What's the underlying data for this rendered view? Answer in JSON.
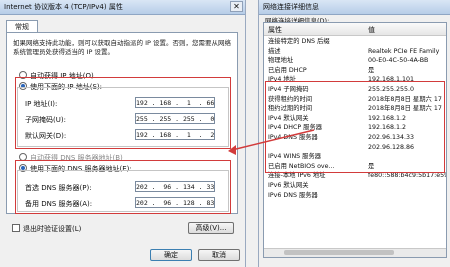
{
  "left_window": {
    "title": "Internet 协议版本 4 (TCP/IPv4) 属性",
    "tab": "常规",
    "description": "如果网络支持此功能，则可以获取自动指派的 IP 设置。否则，您需要从网络系统管理员处获得适当的 IP 设置。",
    "auto_ip": "自动获得 IP 地址(O)",
    "manual_ip": "使用下面的 IP 地址(S):",
    "ip_label": "IP 地址(I):",
    "ip_value": "192 . 168 .  1  . 66",
    "mask_label": "子网掩码(U):",
    "mask_value": "255 . 255 . 255 .  0",
    "gateway_label": "默认网关(D):",
    "gateway_value": "192 . 168 .  1  .  2",
    "auto_dns": "自动获得 DNS 服务器地址(B)",
    "manual_dns": "使用下面的 DNS 服务器地址(E):",
    "dns1_label": "首选 DNS 服务器(P):",
    "dns1_value": "202 .  96 . 134 . 33",
    "dns2_label": "备用 DNS 服务器(A):",
    "dns2_value": "202 .  96 . 128 . 83",
    "validate": "退出时验证设置(L)",
    "advanced": "高级(V)...",
    "ok": "确定",
    "cancel": "取消"
  },
  "right_window": {
    "title": "网络连接详细信息",
    "section": "网络连接详细信息(D):",
    "col_prop": "属性",
    "col_val": "值",
    "rows": [
      {
        "p": "连接特定的 DNS 后缀",
        "v": ""
      },
      {
        "p": "描述",
        "v": "Realtek PCIe FE Family"
      },
      {
        "p": "物理地址",
        "v": "00-E0-4C-50-4A-BB"
      },
      {
        "p": "已启用 DHCP",
        "v": "是"
      },
      {
        "p": "IPv4 地址",
        "v": "192.168.1.101"
      },
      {
        "p": "IPv4 子网掩码",
        "v": "255.255.255.0"
      },
      {
        "p": "获得租约的时间",
        "v": "2018年8月8日 星期六 17"
      },
      {
        "p": "租约过期的时间",
        "v": "2018年8月8日 星期六 17"
      },
      {
        "p": "IPv4 默认网关",
        "v": "192.168.1.2"
      },
      {
        "p": "IPv4 DHCP 服务器",
        "v": "192.168.1.2"
      },
      {
        "p": "IPv4 DNS 服务器",
        "v": "202.96.134.33"
      },
      {
        "p": "",
        "v": "202.96.128.86"
      },
      {
        "p": "IPv4 WINS 服务器",
        "v": ""
      },
      {
        "p": "已启用 NetBIOS ove...",
        "v": "是"
      },
      {
        "p": "连接-本地 IPv6 地址",
        "v": "fe80::588:b4c9:5b17:e59"
      },
      {
        "p": "IPv6 默认网关",
        "v": ""
      },
      {
        "p": "IPv6 DNS 服务器",
        "v": ""
      }
    ]
  },
  "colors": {
    "highlight": "#d23b3b",
    "titlebar": "#c7d8ef"
  }
}
